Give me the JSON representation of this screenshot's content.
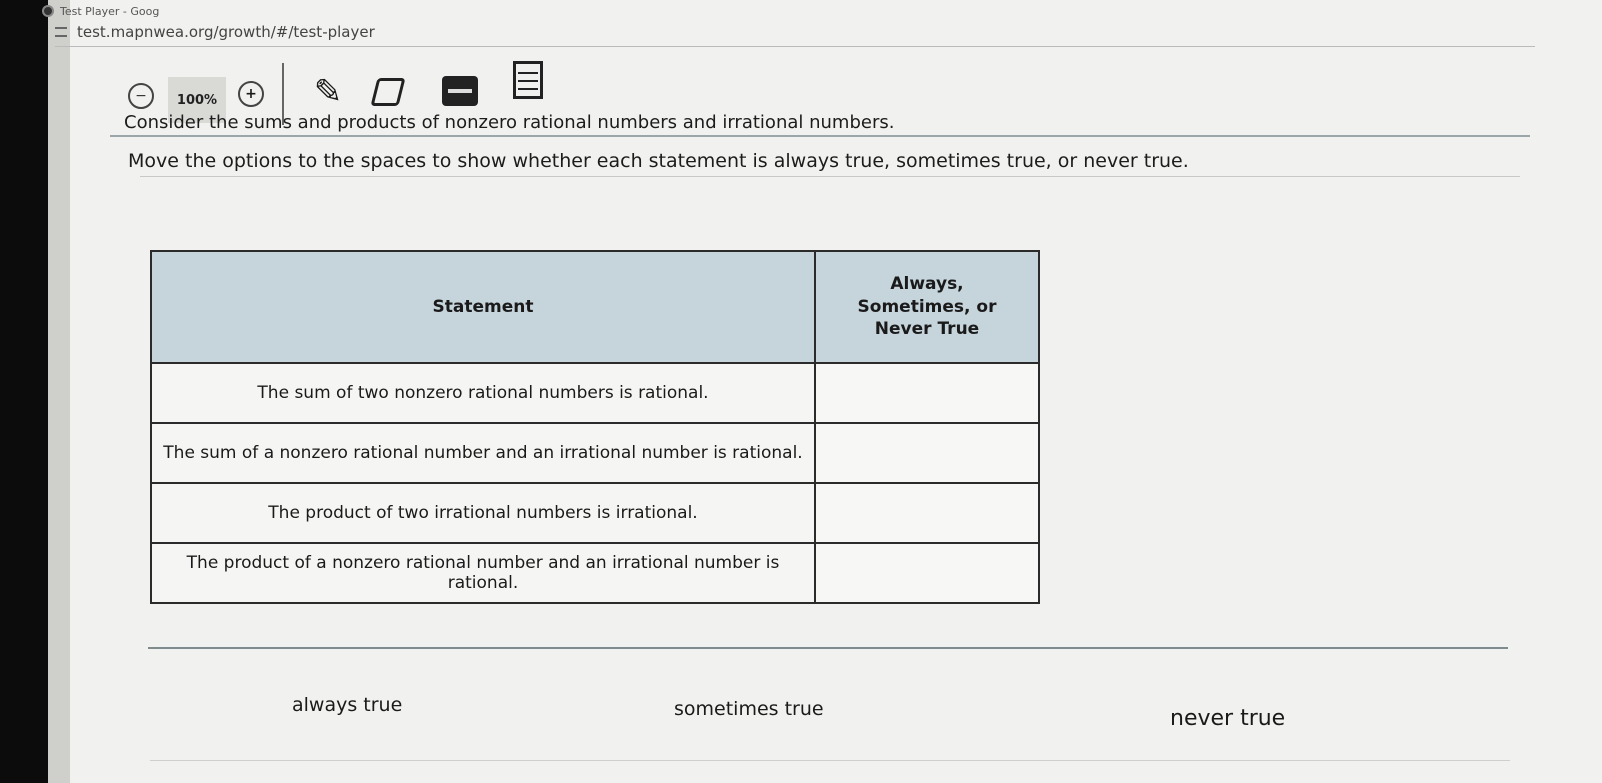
{
  "browser": {
    "tab_title": "Test Player - Goog",
    "url": "test.mapnwea.org/growth/#/test-player"
  },
  "toolbar": {
    "zoom_out_label": "−",
    "zoom_level": "100%",
    "zoom_in_label": "+",
    "pen_glyph": "✎"
  },
  "question": {
    "prompt_line1": "Consider the sums and products of nonzero rational numbers and irrational numbers.",
    "prompt_line2": "Move the options to the spaces to show whether each statement is always true, sometimes true, or never true."
  },
  "table": {
    "headers": {
      "statement": "Statement",
      "answer_line1": "Always,",
      "answer_line2": "Sometimes, or",
      "answer_line3": "Never True"
    },
    "rows": [
      {
        "statement": "The sum of two nonzero rational numbers is rational.",
        "answer": ""
      },
      {
        "statement": "The sum of a nonzero rational number and an irrational number is rational.",
        "answer": ""
      },
      {
        "statement": "The product of two irrational numbers is irrational.",
        "answer": ""
      },
      {
        "statement": "The product of a nonzero rational number and an irrational number is rational.",
        "answer": ""
      }
    ]
  },
  "options": {
    "always": "always true",
    "sometimes": "sometimes true",
    "never": "never true"
  }
}
